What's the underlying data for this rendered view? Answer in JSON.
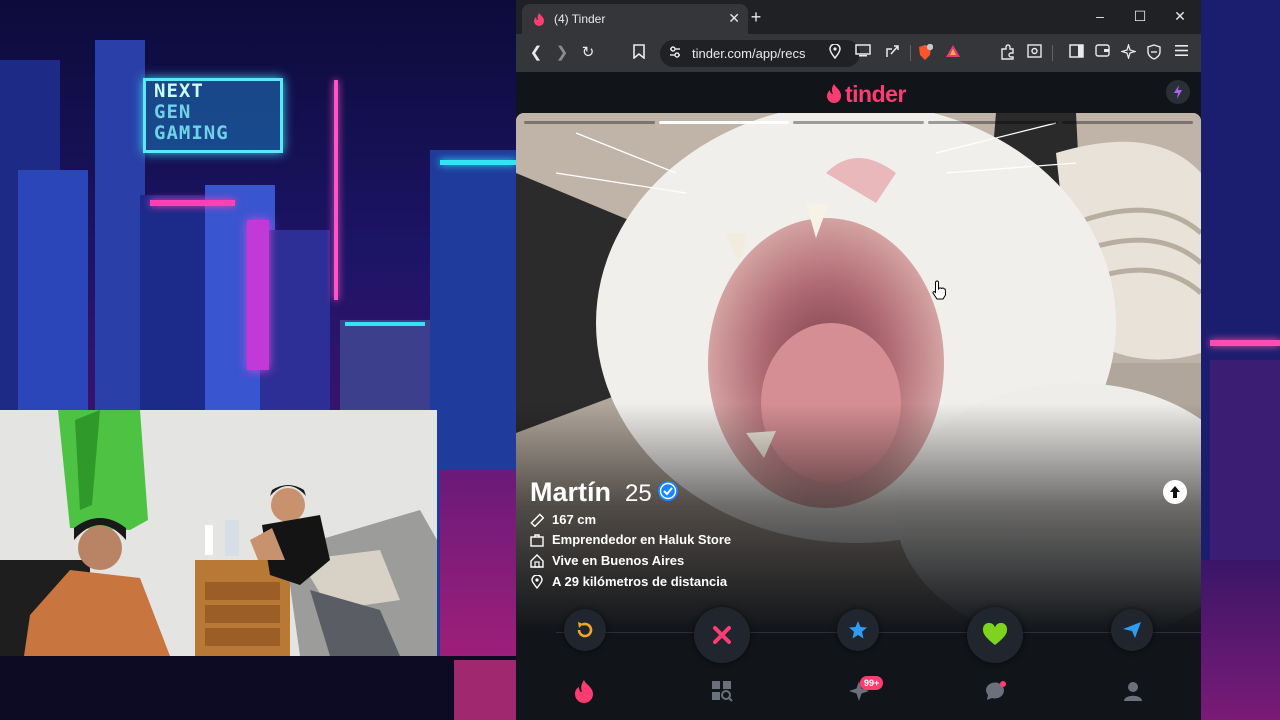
{
  "background": {
    "sign_lines": [
      "NEXT",
      "GEN",
      "GAMING"
    ]
  },
  "browser": {
    "tab": {
      "title": "(4) Tinder",
      "close_glyph": "✕"
    },
    "new_tab_glyph": "+",
    "window_controls": {
      "minimize": "–",
      "maximize": "☐",
      "close": "✕"
    },
    "address": {
      "url": "tinder.com/app/recs"
    },
    "toolbar_icons": [
      "back-icon",
      "forward-icon",
      "reload-icon",
      "bookmark-icon",
      "location-icon",
      "cast-icon",
      "share-icon",
      "brave-shields-icon",
      "brave-rewards-icon",
      "extensions-icon",
      "screenshot-icon",
      "sidebar-icon",
      "wallet-icon",
      "leo-ai-icon",
      "vpn-icon",
      "menu-icon"
    ]
  },
  "tinder": {
    "logo": "tinder",
    "colors": {
      "brand": "#fe3c72",
      "rewind": "#f5a623",
      "nope": "#fe3c72",
      "super_like": "#2f9bf2",
      "like": "#7ed321",
      "boost": "#a266f0"
    },
    "photo": {
      "count": 5,
      "current_index": 2
    },
    "profile": {
      "name": "Martín",
      "age": "25",
      "verified": true,
      "details": [
        {
          "icon": "ruler-icon",
          "text": "167 cm"
        },
        {
          "icon": "briefcase-icon",
          "text": "Emprendedor en Haluk Store"
        },
        {
          "icon": "home-icon",
          "text": "Vive en Buenos Aires"
        },
        {
          "icon": "pin-icon",
          "text": "A 29 kilómetros de distancia"
        }
      ]
    },
    "actions": [
      "rewind-icon",
      "nope-icon",
      "super-like-icon",
      "like-icon",
      "boost-send-icon"
    ],
    "nav": {
      "items": [
        "flame-icon",
        "explore-icon",
        "likes-sparkle-icon",
        "chat-icon",
        "profile-icon"
      ],
      "likes_badge": "99+"
    }
  }
}
